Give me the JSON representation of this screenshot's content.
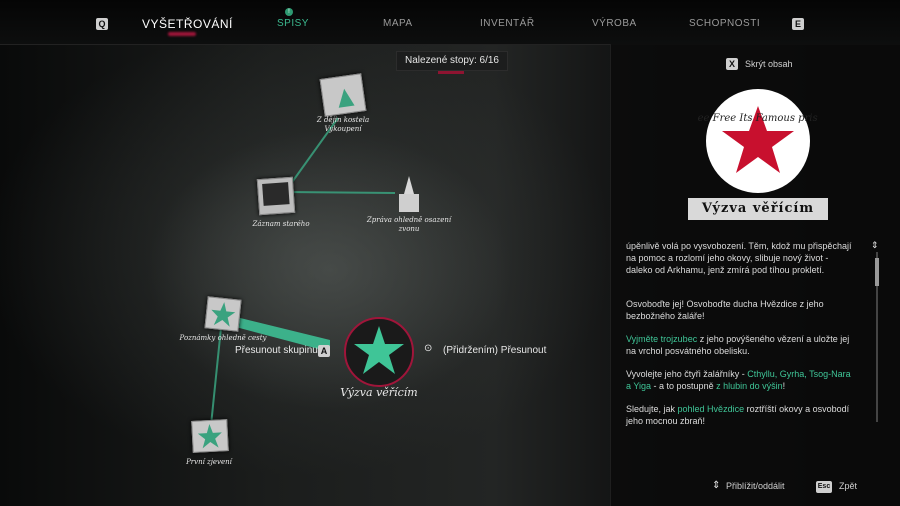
{
  "topbar": {
    "left_key": "Q",
    "right_key": "E",
    "tabs": [
      {
        "label": "VYŠETŘOVÁNÍ",
        "active": true
      },
      {
        "label": "SPISY",
        "badge": "!"
      },
      {
        "label": "MAPA"
      },
      {
        "label": "INVENTÁŘ"
      },
      {
        "label": "VÝROBA"
      },
      {
        "label": "SCHOPNOSTI"
      }
    ]
  },
  "found_clues": "Nalezené stopy:  6/16",
  "nodes": [
    {
      "label": "Z dějin kostela Vykoupení",
      "icon": "photo-card-icon"
    },
    {
      "label": "Záznam starého",
      "icon": "polaroid-icon"
    },
    {
      "label": "Zpráva ohledně osazení zvonu",
      "icon": "church-icon"
    },
    {
      "label": "Poznámky ohledně cesty",
      "icon": "star-card-icon"
    },
    {
      "label": "První zjevení",
      "icon": "star-note-icon"
    },
    {
      "label": "Výzva věřícím",
      "icon": "star-emblem-icon"
    }
  ],
  "context": {
    "move_group_label": "Přesunout skupinu",
    "move_group_key": "A",
    "hold_move_label": "(Přidržením) Přesunout"
  },
  "panel": {
    "hide_key": "X",
    "hide_label": "Skrýt obsah",
    "title": "Výzva věřícím",
    "paragraphs": [
      {
        "text": "úpěnlivě volá po vysvobození. Těm, kdož mu přispěchají na pomoc a rozlomí jeho okovy, slibuje nový život - daleko od Arkhamu, jenž zmírá pod tíhou prokletí."
      },
      {
        "text": "Osvoboďte jej! Osvoboďte ducha Hvězdice z jeho bezbožného žaláře!"
      },
      {
        "hl": "Vyjměte trojzubec",
        "text": " z jeho povýšeného vězení a uložte jej na vrchol posvátného obelisku."
      },
      {
        "pre": "Vyvolejte jeho čtyři žalářníky - ",
        "hl": "Cthyllu, Gyrha, Tsog-Nara a Yiga",
        "mid": " - a to postupně ",
        "hl2": "z hlubin do výšin",
        "post": "!"
      },
      {
        "pre": "Sledujte, jak ",
        "hl": "pohled Hvězdice",
        "post": " roztříští okovy a osvobodí jeho mocnou zbraň!"
      }
    ],
    "emblem_text": "Free Free Its Famous prison"
  },
  "bottom": {
    "zoom_label": "Přiblížit/oddálit",
    "back_key": "Esc",
    "back_label": "Zpět"
  },
  "colors": {
    "accent": "#3bb98f",
    "red": "#a0153a"
  }
}
